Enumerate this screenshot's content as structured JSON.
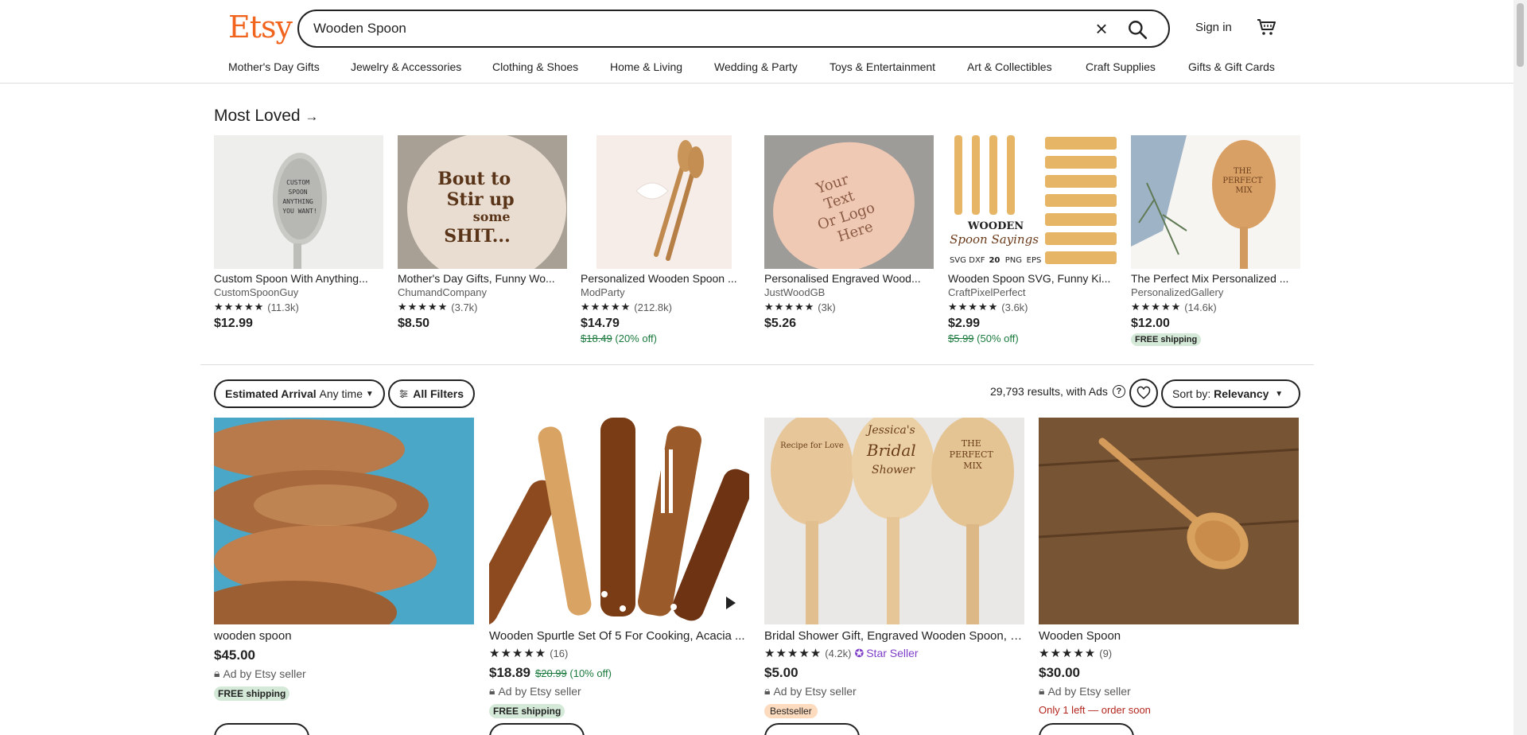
{
  "header": {
    "logo": "Etsy",
    "search_value": "Wooden Spoon",
    "signin": "Sign in",
    "categories": [
      "Mother's Day Gifts",
      "Jewelry & Accessories",
      "Clothing & Shoes",
      "Home & Living",
      "Wedding & Party",
      "Toys & Entertainment",
      "Art & Collectibles",
      "Craft Supplies",
      "Gifts & Gift Cards"
    ]
  },
  "most_loved": {
    "title": "Most Loved",
    "items": [
      {
        "title": "Custom Spoon With Anything...",
        "shop": "CustomSpoonGuy",
        "reviews": "(11.3k)",
        "price": "$12.99",
        "original": "",
        "discount": "",
        "badge": ""
      },
      {
        "title": "Mother's Day Gifts, Funny Wo...",
        "shop": "ChumandCompany",
        "reviews": "(3.7k)",
        "price": "$8.50",
        "original": "",
        "discount": "",
        "badge": ""
      },
      {
        "title": "Personalized Wooden Spoon ...",
        "shop": "ModParty",
        "reviews": "(212.8k)",
        "price": "$14.79",
        "original": "$18.49",
        "discount": "(20% off)",
        "badge": ""
      },
      {
        "title": "Personalised Engraved Wood...",
        "shop": "JustWoodGB",
        "reviews": "(3k)",
        "price": "$5.26",
        "original": "",
        "discount": "",
        "badge": ""
      },
      {
        "title": "Wooden Spoon SVG, Funny Ki...",
        "shop": "CraftPixelPerfect",
        "reviews": "(3.6k)",
        "price": "$2.99",
        "original": "$5.99",
        "discount": "(50% off)",
        "badge": ""
      },
      {
        "title": "The Perfect Mix Personalized ...",
        "shop": "PersonalizedGallery",
        "reviews": "(14.6k)",
        "price": "$12.00",
        "original": "",
        "discount": "",
        "badge": "FREE shipping"
      }
    ]
  },
  "filters": {
    "arrival_label": "Estimated Arrival",
    "arrival_value": "Any time",
    "all_filters": "All Filters",
    "results_text": "29,793 results, with Ads",
    "sort_label": "Sort by:",
    "sort_value": "Relevancy"
  },
  "results": [
    {
      "title": "wooden spoon",
      "reviews": "",
      "star_seller": "",
      "price": "$45.00",
      "original": "",
      "discount": "",
      "ad": "Ad by Etsy seller",
      "badge": "FREE shipping",
      "badge_type": "green"
    },
    {
      "title": "Wooden Spurtle Set Of 5 For Cooking, Acacia ...",
      "reviews": "(16)",
      "star_seller": "",
      "price": "$18.89",
      "original": "$20.99",
      "discount": "(10% off)",
      "ad": "Ad by Etsy seller",
      "badge": "FREE shipping",
      "badge_type": "green"
    },
    {
      "title": "Bridal Shower Gift, Engraved Wooden Spoon, R...",
      "reviews": "(4.2k)",
      "star_seller": "Star Seller",
      "price": "$5.00",
      "original": "",
      "discount": "",
      "ad": "Ad by Etsy seller",
      "badge": "Bestseller",
      "badge_type": "best"
    },
    {
      "title": "Wooden Spoon",
      "reviews": "(9)",
      "star_seller": "",
      "price": "$30.00",
      "original": "",
      "discount": "",
      "ad": "Ad by Etsy seller",
      "badge": "Only 1 left — order soon",
      "badge_type": "warn"
    }
  ],
  "loved_image_text": {
    "img1": [
      "CUSTOM",
      "SPOON",
      "ANYTHING",
      "YOU WANT!"
    ],
    "img2": [
      "Bout to",
      "Stir up",
      "some",
      "SHIT..."
    ],
    "img4": [
      "Your",
      "Text",
      "Or Logo",
      "Here"
    ],
    "img5_heading": [
      "WOODEN",
      "Spoon Sayings"
    ],
    "img5_formats": [
      "SVG",
      "DXF",
      "20",
      "PNG",
      "EPS"
    ],
    "img6": [
      "THE",
      "PERFECT",
      "MIX"
    ]
  },
  "result_image_text": {
    "img3_spoon1": [
      "Recipe for Love"
    ],
    "img3_spoon2": [
      "Jessica's",
      "Bridal",
      "Shower"
    ],
    "img3_spoon3": [
      "THE",
      "PERFECT",
      "MIX"
    ]
  },
  "colors": {
    "brand": "#F1641E",
    "discount_green": "#1b7a3e",
    "star_seller": "#7f3ec9",
    "free_shipping_bg": "#d4e9d7",
    "bestseller_bg": "#fddbbe",
    "warn_red": "#b3261e"
  }
}
